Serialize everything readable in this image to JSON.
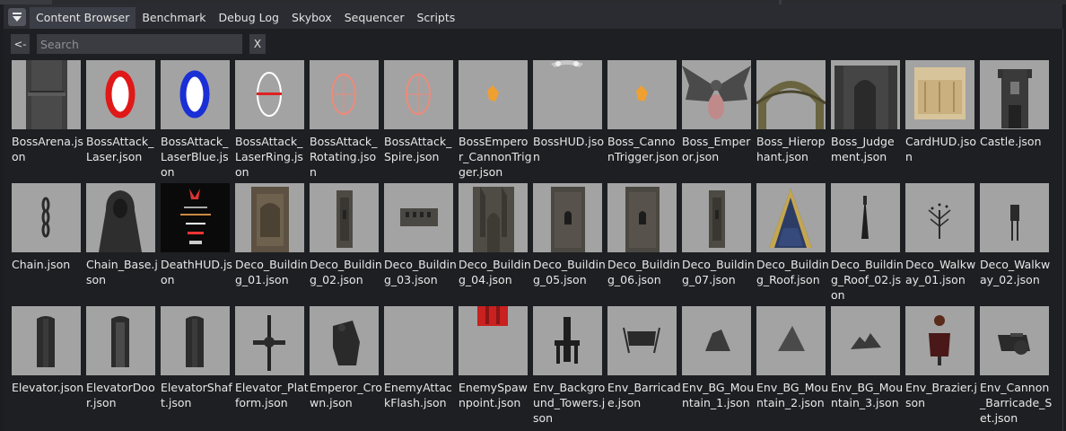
{
  "tabs": [
    {
      "label": "Content Browser",
      "active": true
    },
    {
      "label": "Benchmark"
    },
    {
      "label": "Debug Log"
    },
    {
      "label": "Skybox"
    },
    {
      "label": "Sequencer"
    },
    {
      "label": "Scripts"
    }
  ],
  "search": {
    "back_label": "<-",
    "placeholder": "Search",
    "value": "",
    "clear_label": "X"
  },
  "assets": [
    {
      "name": "BossArena.json",
      "icon": "dark-pillar"
    },
    {
      "name": "BossAttack_Laser.json",
      "icon": "red-ring"
    },
    {
      "name": "BossAttack_LaserBlue.json",
      "icon": "blue-ring"
    },
    {
      "name": "BossAttack_LaserRing.json",
      "icon": "thin-ring"
    },
    {
      "name": "BossAttack_Rotating.json",
      "icon": "pink-ring"
    },
    {
      "name": "BossAttack_Spire.json",
      "icon": "pink-ring"
    },
    {
      "name": "BossEmperor_CannonTrigger.json",
      "icon": "orange-blob"
    },
    {
      "name": "BossHUD.json",
      "icon": "hud-ornament"
    },
    {
      "name": "Boss_CannonTrigger.json",
      "icon": "orange-blob"
    },
    {
      "name": "Boss_Emperor.json",
      "icon": "winged-boss"
    },
    {
      "name": "Boss_Hierophant.json",
      "icon": "arch"
    },
    {
      "name": "Boss_Judgement.json",
      "icon": "cathedral"
    },
    {
      "name": "CardHUD.json",
      "icon": "card"
    },
    {
      "name": "Castle.json",
      "icon": "castle"
    },
    {
      "name": "Chain.json",
      "icon": "chain"
    },
    {
      "name": "Chain_Base.json",
      "icon": "hooded-figure"
    },
    {
      "name": "DeathHUD.json",
      "icon": "death-screen"
    },
    {
      "name": "Deco_Building_01.json",
      "icon": "building-door"
    },
    {
      "name": "Deco_Building_02.json",
      "icon": "building-narrow"
    },
    {
      "name": "Deco_Building_03.json",
      "icon": "building-low"
    },
    {
      "name": "Deco_Building_04.json",
      "icon": "building-gothic"
    },
    {
      "name": "Deco_Building_05.json",
      "icon": "building-window"
    },
    {
      "name": "Deco_Building_06.json",
      "icon": "building-window"
    },
    {
      "name": "Deco_Building_07.json",
      "icon": "building-narrow"
    },
    {
      "name": "Deco_Building_Roof.json",
      "icon": "blue-roof"
    },
    {
      "name": "Deco_Building_Roof_02.json",
      "icon": "spire"
    },
    {
      "name": "Deco_Walkway_01.json",
      "icon": "walkway-tree"
    },
    {
      "name": "Deco_Walkway_02.json",
      "icon": "walkway-banner"
    },
    {
      "name": "Elevator.json",
      "icon": "elevator"
    },
    {
      "name": "ElevatorDoor.json",
      "icon": "elevator-door"
    },
    {
      "name": "ElevatorShaft.json",
      "icon": "elevator"
    },
    {
      "name": "Elevator_Platform.json",
      "icon": "platform"
    },
    {
      "name": "Emperor_Crown.json",
      "icon": "crown"
    },
    {
      "name": "EnemyAttackFlash.json",
      "icon": "empty"
    },
    {
      "name": "EnemySpawnpoint.json",
      "icon": "red-banner"
    },
    {
      "name": "Env_Background_Towers.json",
      "icon": "towers"
    },
    {
      "name": "Env_Barricade.json",
      "icon": "barricade"
    },
    {
      "name": "Env_BG_Mountain_1.json",
      "icon": "mountain-1"
    },
    {
      "name": "Env_BG_Mountain_2.json",
      "icon": "mountain-2"
    },
    {
      "name": "Env_BG_Mountain_3.json",
      "icon": "mountain-3"
    },
    {
      "name": "Env_Brazier.json",
      "icon": "brazier"
    },
    {
      "name": "Env_Cannon_Barricade_Set.json",
      "icon": "cannon-barricade"
    }
  ]
}
